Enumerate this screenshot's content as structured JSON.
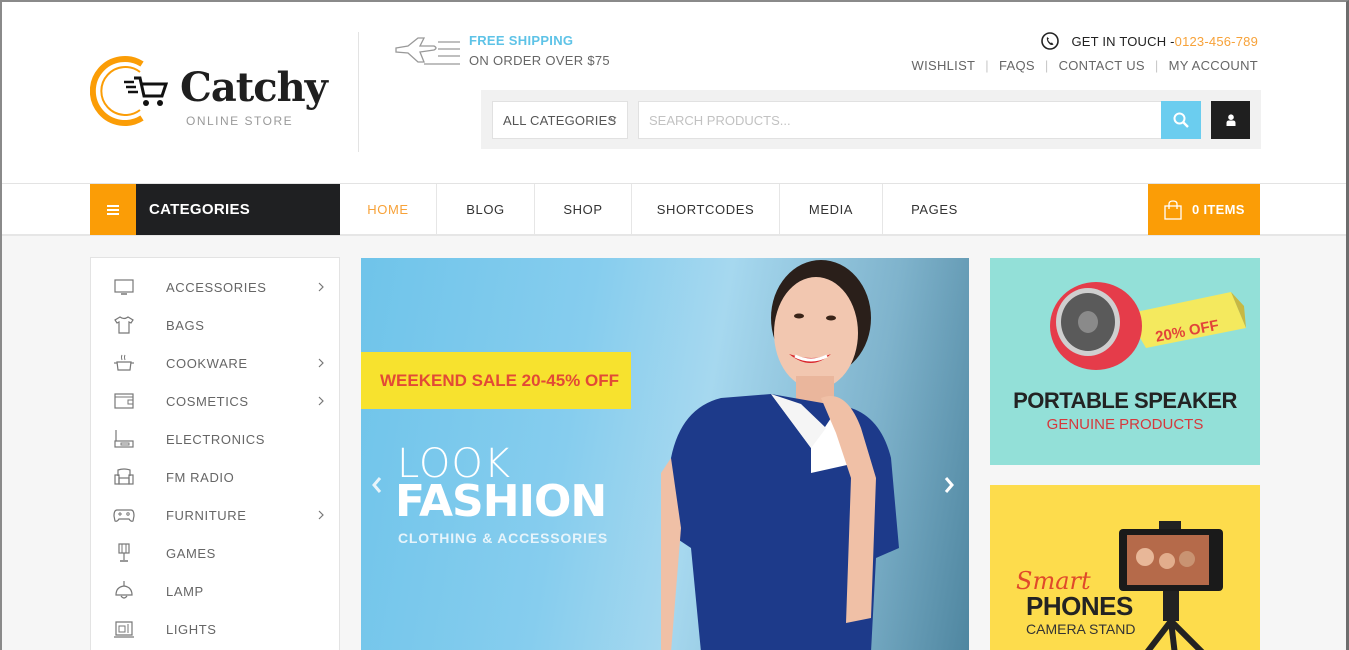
{
  "brand": {
    "name": "Catchy",
    "tagline": "ONLINE STORE",
    "accent_color": "#fb9d06",
    "secondary_color": "#6bcdef"
  },
  "promo": {
    "icon": "airplane-icon",
    "title": "FREE SHIPPING",
    "subtitle": "ON ORDER OVER $75"
  },
  "contact": {
    "icon": "phone-icon",
    "label": "GET IN TOUCH -",
    "phone": "0123-456-789"
  },
  "top_links": [
    {
      "label": "WISHLIST"
    },
    {
      "label": "FAQS"
    },
    {
      "label": "CONTACT US"
    },
    {
      "label": "MY ACCOUNT"
    }
  ],
  "search": {
    "category_selected": "ALL CATEGORIES",
    "placeholder": "SEARCH PRODUCTS...",
    "value": "",
    "search_icon": "search-icon",
    "user_icon": "user-icon"
  },
  "nav": {
    "categories_label": "CATEGORIES",
    "menu": [
      {
        "label": "HOME",
        "active": true
      },
      {
        "label": "BLOG",
        "active": false
      },
      {
        "label": "SHOP",
        "active": false
      },
      {
        "label": "SHORTCODES",
        "active": false
      },
      {
        "label": "MEDIA",
        "active": false
      },
      {
        "label": "PAGES",
        "active": false
      }
    ],
    "cart_label": "0 ITEMS"
  },
  "sidebar": {
    "items": [
      {
        "label": "ACCESSORIES",
        "icon": "monitor-icon",
        "has_submenu": true
      },
      {
        "label": "BAGS",
        "icon": "tshirt-icon",
        "has_submenu": false
      },
      {
        "label": "COOKWARE",
        "icon": "pot-icon",
        "has_submenu": true
      },
      {
        "label": "COSMETICS",
        "icon": "wallet-icon",
        "has_submenu": true
      },
      {
        "label": "ELECTRONICS",
        "icon": "router-icon",
        "has_submenu": false
      },
      {
        "label": "FM RADIO",
        "icon": "armchair-icon",
        "has_submenu": false
      },
      {
        "label": "FURNITURE",
        "icon": "gamepad-icon",
        "has_submenu": true
      },
      {
        "label": "GAMES",
        "icon": "table-lamp-icon",
        "has_submenu": false
      },
      {
        "label": "LAMP",
        "icon": "pendant-lamp-icon",
        "has_submenu": false
      },
      {
        "label": "LIGHTS",
        "icon": "sewing-machine-icon",
        "has_submenu": false
      }
    ]
  },
  "hero": {
    "sale_text": "WEEKEND SALE 20-45% OFF",
    "line1": "LOOK",
    "line2": "FASHION",
    "line3": "CLOTHING & ACCESSORIES"
  },
  "banners": [
    {
      "badge": "20% OFF",
      "title": "PORTABLE SPEAKER",
      "subtitle": "GENUINE PRODUCTS"
    },
    {
      "script": "Smart",
      "title": "PHONES",
      "subtitle": "CAMERA STAND"
    }
  ]
}
